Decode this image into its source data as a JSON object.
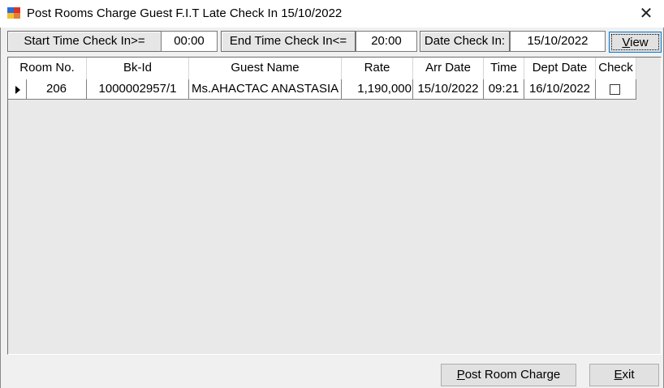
{
  "window": {
    "title": "Post Rooms Charge Guest F.I.T Late Check In 15/10/2022",
    "close_glyph": "✕",
    "icon": "app-window-icon"
  },
  "filters": {
    "start_label": "Start Time Check In>=",
    "start_value": "00:00",
    "end_label": "End Time Check In<=",
    "end_value": "20:00",
    "date_label": "Date Check In:",
    "date_value": "15/10/2022",
    "view_label_accel": "V",
    "view_label_rest": "iew"
  },
  "grid": {
    "columns": [
      "Room No.",
      "Bk-Id",
      "Guest Name",
      "Rate",
      "Arr Date",
      "Time",
      "Dept Date",
      "Check"
    ],
    "rows": [
      {
        "room_no": "206",
        "bk_id": "1000002957/1",
        "guest_name": "Ms.AHACTAC ANASTASIA",
        "rate": "1,190,000",
        "arr_date": "15/10/2022",
        "time": "09:21",
        "dept_date": "16/10/2022",
        "checked": false
      }
    ]
  },
  "buttons": {
    "post_accel": "P",
    "post_rest": "ost Room Charge",
    "exit_accel": "E",
    "exit_rest": "xit"
  },
  "colors": {
    "window_bg": "#f0f0f0",
    "focus_border": "#0078d7",
    "icon_red": "#d9342b",
    "icon_blue": "#2b6cd9",
    "icon_yellow": "#f2c12e"
  }
}
